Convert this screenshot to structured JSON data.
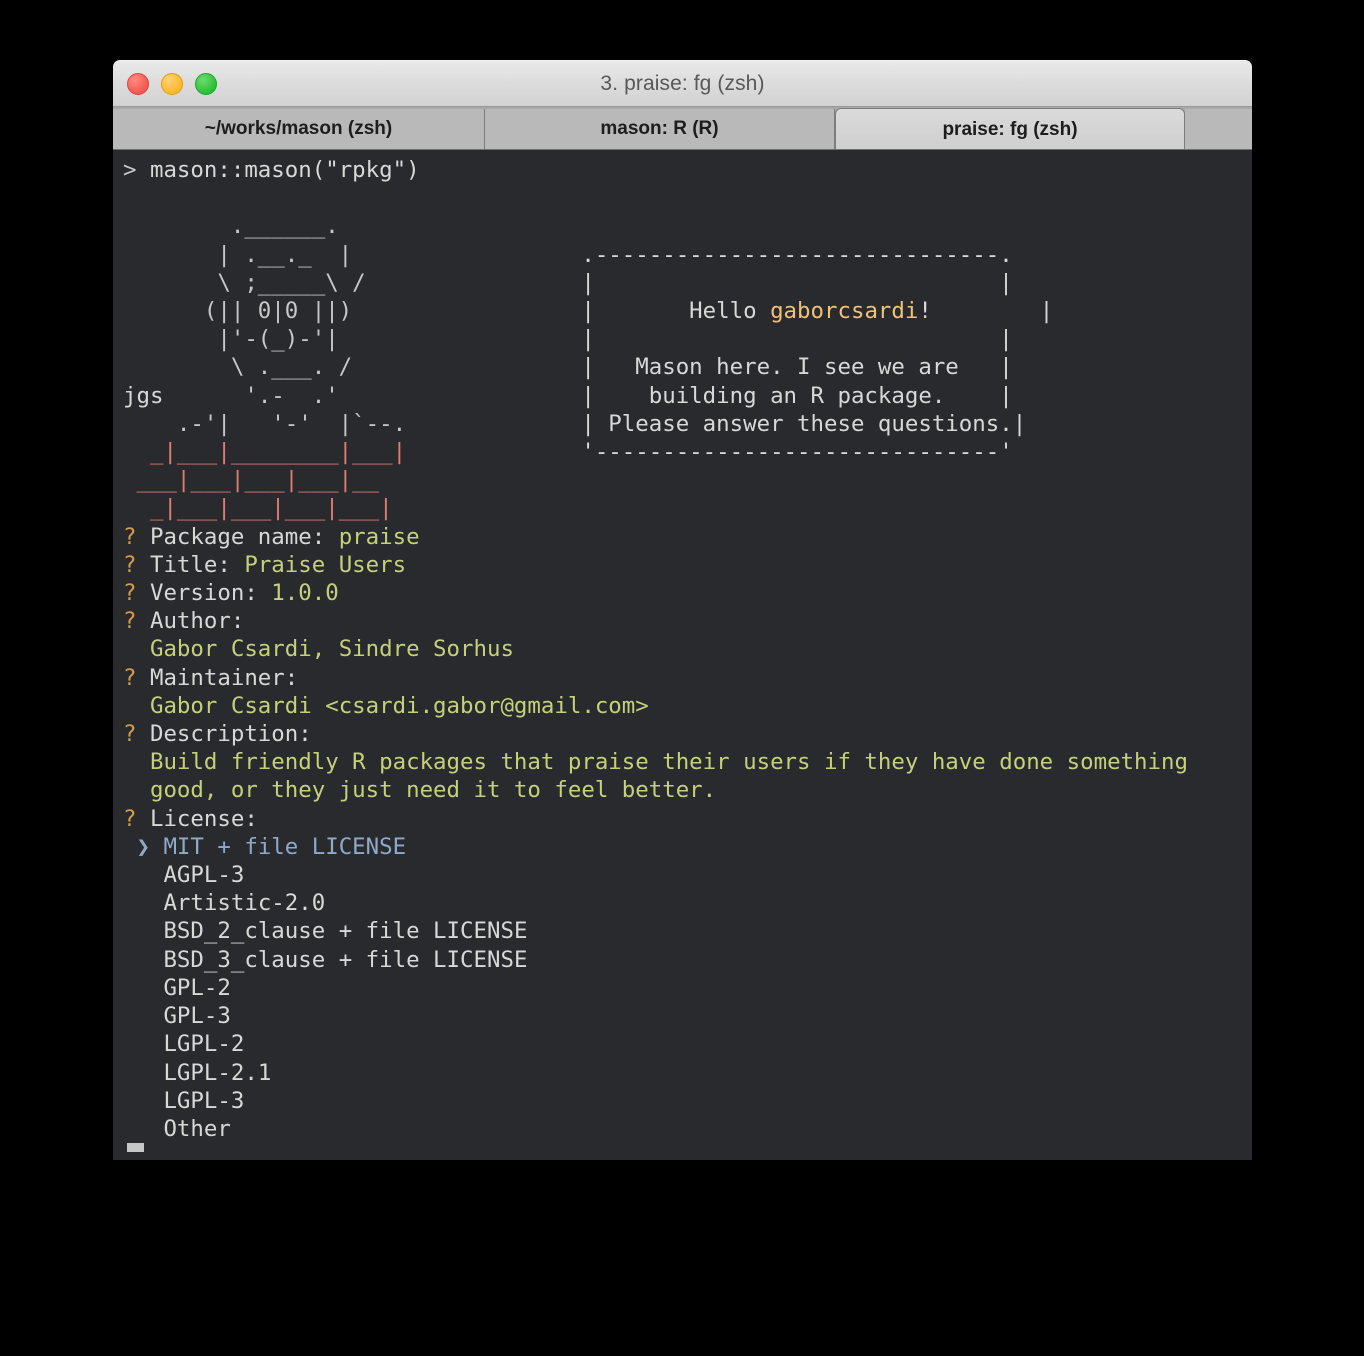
{
  "window": {
    "title": "3. praise: fg (zsh)",
    "controls": [
      {
        "name": "close",
        "color": "#f35750"
      },
      {
        "name": "minimize",
        "color": "#fcb827"
      },
      {
        "name": "maximize",
        "color": "#28c038"
      }
    ]
  },
  "tabs": [
    {
      "label": "~/works/mason (zsh)",
      "active": false
    },
    {
      "label": "mason: R (R)",
      "active": false
    },
    {
      "label": "praise: fg (zsh)",
      "active": true
    }
  ],
  "terminal": {
    "prompt_line": {
      "prompt": "> ",
      "command": "mason::mason(\"rpkg\")"
    },
    "ascii_art": {
      "signature": "jgs",
      "head_lines": [
        "         .______.",
        "        | .__._  |",
        "        \\ ;____\\ /",
        "       (|| 0|0 ||)",
        "        |'-(_)-'|",
        "         \\ .___. /",
        "jgs       '.-  .'"
      ],
      "wall_lines": [
        "   .-'|   '-'  |`--.",
        " _|___|________|___|",
        "___|___|___|___|___|__",
        " _|___|___|___|___|___|"
      ]
    },
    "message_box": {
      "greeting_prefix": "Hello ",
      "username": "gaborcsardi",
      "greeting_suffix": "!",
      "lines": [
        "Mason here. I see we are",
        "building an R package.",
        "Please answer these questions."
      ]
    },
    "questions": [
      {
        "marker": "?",
        "label": "Package name:",
        "value": "praise",
        "inline": true
      },
      {
        "marker": "?",
        "label": "Title:",
        "value": "Praise Users",
        "inline": true
      },
      {
        "marker": "?",
        "label": "Version:",
        "value": "1.0.0",
        "inline": true
      },
      {
        "marker": "?",
        "label": "Author:",
        "value": "Gabor Csardi, Sindre Sorhus",
        "inline": false
      },
      {
        "marker": "?",
        "label": "Maintainer:",
        "value": "Gabor Csardi <csardi.gabor@gmail.com>",
        "inline": false
      },
      {
        "marker": "?",
        "label": "Description:",
        "value": "Build friendly R packages that praise their users if they have done something",
        "value2": "good, or they just need it to feel better.",
        "inline": false
      }
    ],
    "license_prompt": {
      "marker": "?",
      "label": "License:"
    },
    "license_options": [
      {
        "label": "MIT + file LICENSE",
        "selected": true,
        "pointer": "❯"
      },
      {
        "label": "AGPL-3",
        "selected": false
      },
      {
        "label": "Artistic-2.0",
        "selected": false
      },
      {
        "label": "BSD_2_clause + file LICENSE",
        "selected": false
      },
      {
        "label": "BSD_3_clause + file LICENSE",
        "selected": false
      },
      {
        "label": "GPL-2",
        "selected": false
      },
      {
        "label": "GPL-3",
        "selected": false
      },
      {
        "label": "LGPL-2",
        "selected": false
      },
      {
        "label": "LGPL-2.1",
        "selected": false
      },
      {
        "label": "LGPL-3",
        "selected": false
      },
      {
        "label": "Other",
        "selected": false
      }
    ],
    "cursor": "block"
  },
  "colors": {
    "terminal_bg": "#282a2e",
    "foreground": "#c5c8c6",
    "brick_red": "#e07b70",
    "question_orange": "#d79a4b",
    "value_green": "#c6d07b",
    "username_tan": "#f0c278",
    "selected_blue": "#8fa9c8"
  }
}
